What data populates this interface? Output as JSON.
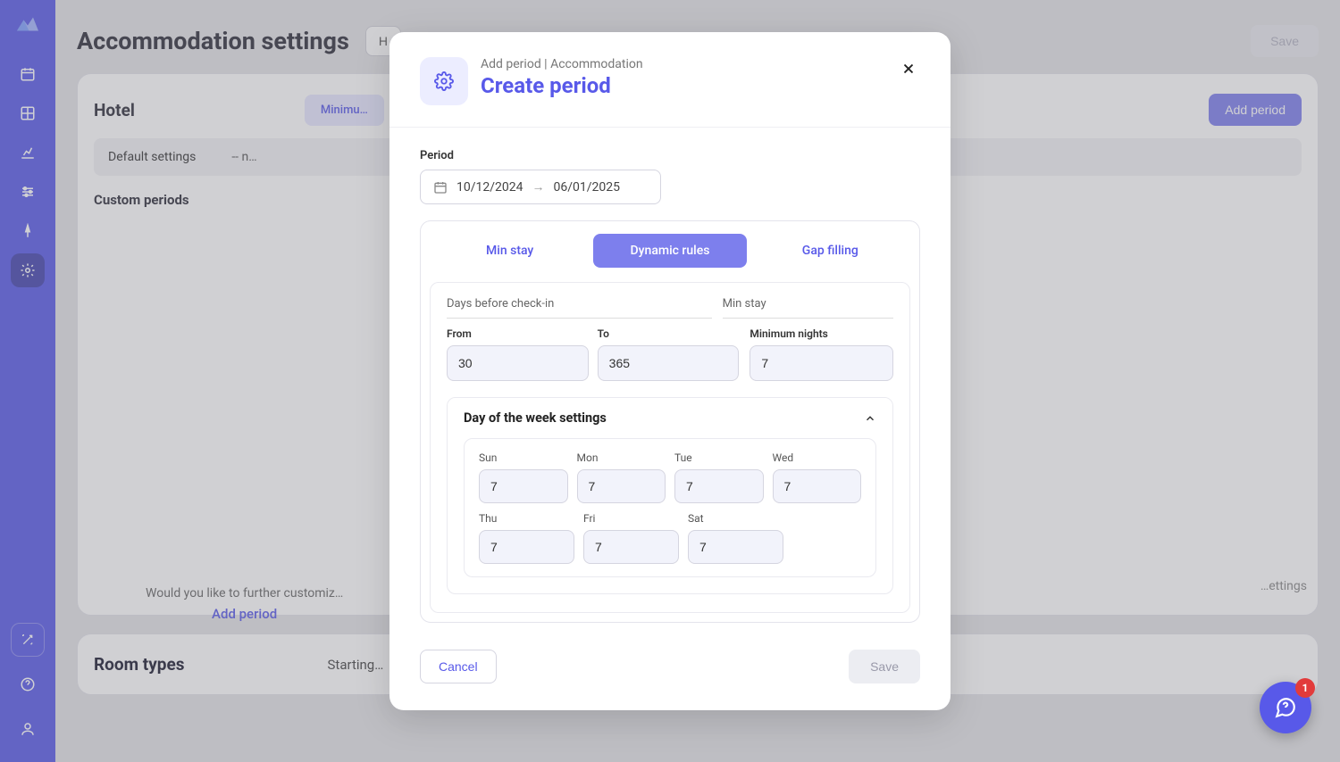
{
  "sidebar": {
    "items": [
      {
        "name": "calendar"
      },
      {
        "name": "grid"
      },
      {
        "name": "analytics"
      },
      {
        "name": "sliders"
      },
      {
        "name": "compass"
      }
    ],
    "active_name": "settings"
  },
  "header": {
    "page_title": "Accommodation settings",
    "hotel_btn": "H",
    "save_label": "Save"
  },
  "hotel_card": {
    "title": "Hotel",
    "tab_label": "Minimu…",
    "add_period_label": "Add period",
    "default_row": {
      "label": "Default settings",
      "value": "-- n…"
    },
    "custom_periods_label": "Custom periods",
    "prompt_line": "Would you like to further customiz…",
    "add_period_link": "Add period",
    "settings_trunc": "…ettings"
  },
  "room_types": {
    "title": "Room types",
    "starting": "Starting…"
  },
  "modal": {
    "subtitle": "Add period | Accommodation",
    "title": "Create period",
    "period_label": "Period",
    "date_from": "10/12/2024",
    "date_to": "06/01/2025",
    "tabs": {
      "min_stay": "Min stay",
      "dynamic": "Dynamic rules",
      "gap": "Gap filling"
    },
    "col_days": "Days before check-in",
    "col_min": "Min stay",
    "from_label": "From",
    "from_value": "30",
    "to_label": "To",
    "to_value": "365",
    "min_nights_label": "Minimum nights",
    "min_nights_value": "7",
    "dow": {
      "title": "Day of the week settings",
      "sun": {
        "label": "Sun",
        "value": "7"
      },
      "mon": {
        "label": "Mon",
        "value": "7"
      },
      "tue": {
        "label": "Tue",
        "value": "7"
      },
      "wed": {
        "label": "Wed",
        "value": "7"
      },
      "thu": {
        "label": "Thu",
        "value": "7"
      },
      "fri": {
        "label": "Fri",
        "value": "7"
      },
      "sat": {
        "label": "Sat",
        "value": "7"
      }
    },
    "cancel_label": "Cancel",
    "save_label": "Save"
  },
  "fab": {
    "badge": "1"
  }
}
